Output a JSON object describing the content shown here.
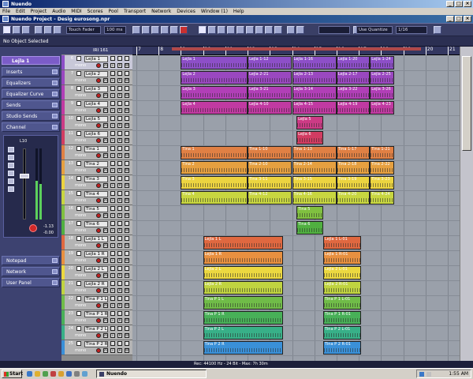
{
  "window": {
    "title": "Nuendo",
    "controls": [
      "_",
      "□",
      "×"
    ]
  },
  "menu": [
    "File",
    "Edit",
    "Project",
    "Audio",
    "MIDI",
    "Scores",
    "Pool",
    "Transport",
    "Network",
    "Devices",
    "Window (1)",
    "Help"
  ],
  "project_window": {
    "title": "Nuendo Project - Desig eurosong.npr"
  },
  "toolbar": {
    "automation_mode": "Touch Fader",
    "zoom": "100 ms",
    "quantize_type": "Use Quantize",
    "quantize_value": "1/16"
  },
  "infobar": {
    "text": "No Object Selected"
  },
  "inspector": {
    "track_name": "Lejla 1",
    "sections": [
      "Inserts",
      "Equalizers",
      "Equalizer Curve",
      "Sends",
      "Studio Sends",
      "Channel"
    ],
    "bottom_sections": [
      "Notepad",
      "Network",
      "User Panel"
    ],
    "channel": {
      "pan": "L10",
      "volume_readout": "-0.00",
      "meter_level": 0.55,
      "peak": "-1.13"
    }
  },
  "tracklist": {
    "header": "IRI 161",
    "mono": "mono"
  },
  "tracks": [
    {
      "num": "6",
      "name": "Lejla 1",
      "color": "#8d4fc8"
    },
    {
      "num": "7",
      "name": "Lejla 2",
      "color": "#9a48c0"
    },
    {
      "num": "8",
      "name": "Lejla 3",
      "color": "#b13fb7"
    },
    {
      "num": "9",
      "name": "Lejla 4",
      "color": "#c13aa2"
    },
    {
      "num": "10",
      "name": "Lejla 5",
      "color": "#cc3b85"
    },
    {
      "num": "11",
      "name": "Lejla 6",
      "color": "#d23c62"
    },
    {
      "num": "12",
      "name": "Tina 1",
      "color": "#e08044"
    },
    {
      "num": "13",
      "name": "Tina 2",
      "color": "#e6a040"
    },
    {
      "num": "14",
      "name": "Tina 3",
      "color": "#ecd440"
    },
    {
      "num": "15",
      "name": "Tina 4",
      "color": "#c8d640"
    },
    {
      "num": "16",
      "name": "Tina 5",
      "color": "#80c040"
    },
    {
      "num": "17",
      "name": "Tina 6",
      "color": "#50b040"
    },
    {
      "num": "18",
      "name": "Lejla 1 L",
      "color": "#e06840"
    },
    {
      "num": "19",
      "name": "Lejla 1 R",
      "color": "#e89040"
    },
    {
      "num": "20",
      "name": "Lejla 2 L",
      "color": "#ecd840"
    },
    {
      "num": "21",
      "name": "Lejla 2 R",
      "color": "#c0d440"
    },
    {
      "num": "22",
      "name": "Tina P 1 L",
      "color": "#70bc48"
    },
    {
      "num": "23",
      "name": "Tina P 1 R",
      "color": "#48b058"
    },
    {
      "num": "24",
      "name": "Tina P 2 L",
      "color": "#38b088"
    },
    {
      "num": "25",
      "name": "Tina P 2 R",
      "color": "#3a90d8"
    }
  ],
  "ruler": {
    "bars": [
      "7",
      "8",
      "9",
      "10",
      "11",
      "12",
      "13",
      "14",
      "15",
      "16",
      "17",
      "18",
      "19",
      "20",
      "21"
    ]
  },
  "events": [
    {
      "track": 0,
      "start": 9,
      "end": 12,
      "label": "Lejla 1"
    },
    {
      "track": 0,
      "start": 12,
      "end": 14,
      "label": "Lejla 1-12"
    },
    {
      "track": 0,
      "start": 14,
      "end": 16,
      "label": "Lejla 1-16"
    },
    {
      "track": 0,
      "start": 16,
      "end": 17.5,
      "label": "Lejla 1-20"
    },
    {
      "track": 0,
      "start": 17.5,
      "end": 18.6,
      "label": "Lejla 1-24"
    },
    {
      "track": 1,
      "start": 9,
      "end": 12,
      "label": "Lejla 2"
    },
    {
      "track": 1,
      "start": 12,
      "end": 14,
      "label": "Lejla 2-21"
    },
    {
      "track": 1,
      "start": 14,
      "end": 16,
      "label": "Lejla 2-13"
    },
    {
      "track": 1,
      "start": 16,
      "end": 17.5,
      "label": "Lejla 2-17"
    },
    {
      "track": 1,
      "start": 17.5,
      "end": 18.6,
      "label": "Lejla 2-25"
    },
    {
      "track": 2,
      "start": 9,
      "end": 12,
      "label": "Lejla 3"
    },
    {
      "track": 2,
      "start": 12,
      "end": 14,
      "label": "Lejla 3-21"
    },
    {
      "track": 2,
      "start": 14,
      "end": 16,
      "label": "Lejla 3-14"
    },
    {
      "track": 2,
      "start": 16,
      "end": 17.5,
      "label": "Lejla 3-22"
    },
    {
      "track": 2,
      "start": 17.5,
      "end": 18.6,
      "label": "Lejla 3-26"
    },
    {
      "track": 3,
      "start": 9,
      "end": 12,
      "label": "Lejla 4"
    },
    {
      "track": 3,
      "start": 12,
      "end": 14,
      "label": "Lejla 4-10"
    },
    {
      "track": 3,
      "start": 14,
      "end": 16,
      "label": "Lejla 4-15"
    },
    {
      "track": 3,
      "start": 16,
      "end": 17.5,
      "label": "Lejla 4-19"
    },
    {
      "track": 3,
      "start": 17.5,
      "end": 18.6,
      "label": "Lejla 4-23"
    },
    {
      "track": 4,
      "start": 14.2,
      "end": 15.4,
      "label": "Lejla 5"
    },
    {
      "track": 5,
      "start": 14.2,
      "end": 15.4,
      "label": "Lejla 6"
    },
    {
      "track": 6,
      "start": 9,
      "end": 12,
      "label": "Tina 1"
    },
    {
      "track": 6,
      "start": 12,
      "end": 14,
      "label": "Tina 1-10"
    },
    {
      "track": 6,
      "start": 14,
      "end": 16,
      "label": "Tina 1-13"
    },
    {
      "track": 6,
      "start": 16,
      "end": 17.5,
      "label": "Tina 1-17"
    },
    {
      "track": 6,
      "start": 17.5,
      "end": 18.6,
      "label": "Tina 1-21"
    },
    {
      "track": 7,
      "start": 9,
      "end": 12,
      "label": "Tina 2"
    },
    {
      "track": 7,
      "start": 12,
      "end": 14,
      "label": "Tina 2-10"
    },
    {
      "track": 7,
      "start": 14,
      "end": 16,
      "label": "Tina 2-14"
    },
    {
      "track": 7,
      "start": 16,
      "end": 17.5,
      "label": "Tina 2-18"
    },
    {
      "track": 7,
      "start": 17.5,
      "end": 18.6,
      "label": "Tina 2-22"
    },
    {
      "track": 8,
      "start": 9,
      "end": 12,
      "label": "Tina 3"
    },
    {
      "track": 8,
      "start": 12,
      "end": 14,
      "label": "Tina 3-11"
    },
    {
      "track": 8,
      "start": 14,
      "end": 16,
      "label": "Tina 3-15"
    },
    {
      "track": 8,
      "start": 16,
      "end": 17.5,
      "label": "Tina 3-19"
    },
    {
      "track": 8,
      "start": 17.5,
      "end": 18.6,
      "label": "Tina 3-23"
    },
    {
      "track": 9,
      "start": 9,
      "end": 12,
      "label": "Tina 4"
    },
    {
      "track": 9,
      "start": 12,
      "end": 14,
      "label": "Tina 4-12"
    },
    {
      "track": 9,
      "start": 14,
      "end": 16,
      "label": "Tina 4-16"
    },
    {
      "track": 9,
      "start": 16,
      "end": 17.5,
      "label": "Tina 4-20"
    },
    {
      "track": 9,
      "start": 17.5,
      "end": 18.6,
      "label": "Tina 4-24"
    },
    {
      "track": 10,
      "start": 14.2,
      "end": 15.4,
      "label": "Tina 5"
    },
    {
      "track": 11,
      "start": 14.2,
      "end": 15.4,
      "label": "Tina 6"
    },
    {
      "track": 12,
      "start": 10,
      "end": 13.6,
      "label": "Lejla 1 L"
    },
    {
      "track": 12,
      "start": 15.4,
      "end": 17.1,
      "label": "Lejla 1 L-01"
    },
    {
      "track": 13,
      "start": 10,
      "end": 13.6,
      "label": "Lejla 1 R"
    },
    {
      "track": 13,
      "start": 15.4,
      "end": 17.1,
      "label": "Lejla 1 R-01"
    },
    {
      "track": 14,
      "start": 10,
      "end": 13.6,
      "label": "Lejla 2 L"
    },
    {
      "track": 14,
      "start": 15.4,
      "end": 17.1,
      "label": "Lejla 2 L-01"
    },
    {
      "track": 15,
      "start": 10,
      "end": 13.6,
      "label": "Lejla 2 R"
    },
    {
      "track": 15,
      "start": 15.4,
      "end": 17.1,
      "label": "Lejla 2 R-01"
    },
    {
      "track": 16,
      "start": 10,
      "end": 13.6,
      "label": "Tina P 1 L"
    },
    {
      "track": 16,
      "start": 15.4,
      "end": 17.1,
      "label": "Tina P 1 L-01"
    },
    {
      "track": 17,
      "start": 10,
      "end": 13.6,
      "label": "Tina P 1 R"
    },
    {
      "track": 17,
      "start": 15.4,
      "end": 17.1,
      "label": "Tina P 1 R-01"
    },
    {
      "track": 18,
      "start": 10,
      "end": 13.6,
      "label": "Tina P 2 L"
    },
    {
      "track": 18,
      "start": 15.4,
      "end": 17.1,
      "label": "Tina P 2 L-01"
    },
    {
      "track": 19,
      "start": 10,
      "end": 13.6,
      "label": "Tina P 2 R"
    },
    {
      "track": 19,
      "start": 15.4,
      "end": 17.1,
      "label": "Tina P 2 R-01"
    }
  ],
  "statusbar": {
    "text": "Rec: 44100 Hz - 24 Bit - Max: 7h 30m"
  },
  "taskbar": {
    "start": "Start",
    "app": "Nuendo",
    "time": "1:55 AM"
  }
}
